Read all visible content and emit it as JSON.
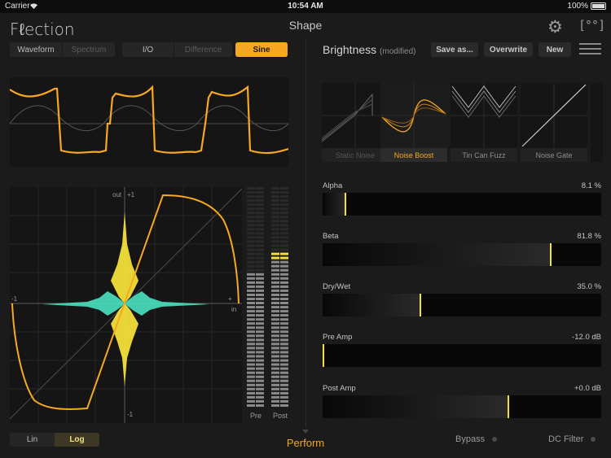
{
  "status_bar": {
    "carrier": "Carrier",
    "time": "10:54 AM",
    "battery": "100%"
  },
  "app": {
    "logo": "Fℓection",
    "title": "Shape"
  },
  "icons": {
    "settings": "gear-icon",
    "fullscreen": "brackets-icon",
    "menu": "hamburger-icon"
  },
  "view_tabs": {
    "waveform": "Waveform",
    "spectrum": "Spectrum",
    "io": "I/O",
    "difference": "Difference",
    "sine": "Sine"
  },
  "transfer": {
    "out_label": "out",
    "in_label": "in",
    "top_tick": "+1",
    "bottom_tick": "-1",
    "left_tick": "-1",
    "right_tick": "+"
  },
  "meters": {
    "pre": "Pre",
    "post": "Post",
    "pre_level": 0.62,
    "post_level": 0.72
  },
  "scale_toggle": {
    "lin": "Lin",
    "log": "Log",
    "selected": "Log"
  },
  "perform_label": "Perform",
  "preset": {
    "name": "Brightness",
    "modified": "(modified)",
    "save_as": "Save as...",
    "overwrite": "Overwrite",
    "new": "New",
    "tiles": [
      {
        "name": "Static Noise",
        "state": "dim"
      },
      {
        "name": "Noise Boost",
        "state": "selected"
      },
      {
        "name": "Tin Can Fuzz",
        "state": "normal"
      },
      {
        "name": "Noise Gate",
        "state": "normal"
      }
    ]
  },
  "params": [
    {
      "label": "Alpha",
      "value": "8.1 %",
      "level": 0.081
    },
    {
      "label": "Beta",
      "value": "81.8 %",
      "level": 0.818
    },
    {
      "label": "Dry/Wet",
      "value": "35.0 %",
      "level": 0.35
    },
    {
      "label": "Pre Amp",
      "value": "-12.0 dB",
      "level": 0.0
    },
    {
      "label": "Post Amp",
      "value": "+0.0 dB",
      "level": 0.667
    }
  ],
  "toggles": {
    "bypass": "Bypass",
    "dc_filter": "DC Filter"
  },
  "colors": {
    "accent": "#f7a823",
    "meter": "#f2df3a",
    "spectrum": "#49e1bf"
  }
}
